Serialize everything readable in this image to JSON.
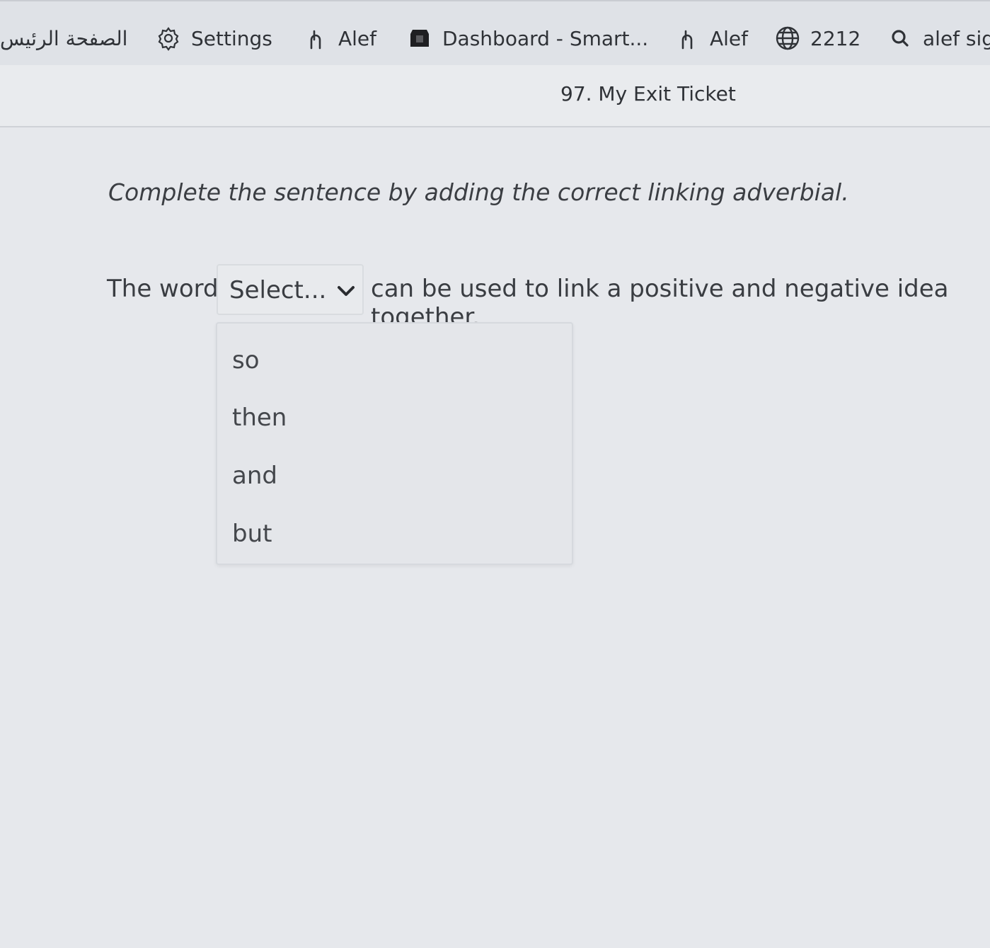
{
  "bookmarks": [
    {
      "label": "الصفحة الرئيس",
      "icon": ""
    },
    {
      "label": "Settings",
      "icon": "gear-icon"
    },
    {
      "label": "Alef",
      "icon": "alef-icon"
    },
    {
      "label": "Dashboard - Smart...",
      "icon": "emblem-icon"
    },
    {
      "label": "Alef",
      "icon": "alef-icon"
    },
    {
      "label": "2212",
      "icon": "globe-icon"
    },
    {
      "label": "alef sig",
      "icon": "search-icon"
    }
  ],
  "page": {
    "title": "97. My Exit Ticket"
  },
  "question": {
    "instruction": "Complete the sentence by adding the correct linking adverbial.",
    "before": "The word",
    "after": "can be used to link a positive and negative idea together.",
    "select_placeholder": "Select...",
    "options": [
      "so",
      "then",
      "and",
      "but"
    ]
  }
}
